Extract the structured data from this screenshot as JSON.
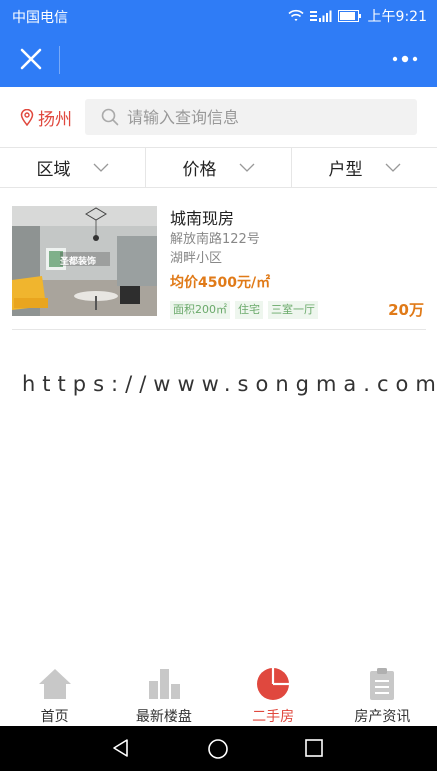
{
  "status_bar": {
    "carrier": "中国电信",
    "time": "上午9:21"
  },
  "nav": {
    "close_icon": "close-icon",
    "more_icon": "more-icon"
  },
  "search": {
    "city": "扬州",
    "placeholder": "请输入查询信息"
  },
  "filters": [
    {
      "label": "区域"
    },
    {
      "label": "价格"
    },
    {
      "label": "户型"
    }
  ],
  "listings": [
    {
      "title": "城南现房",
      "address": "解放南路122号",
      "community": "湖畔小区",
      "unit_price": "均价4500元/㎡",
      "tags": [
        "面积200㎡",
        "住宅",
        "三室一厅"
      ],
      "total_price": "20万",
      "image_logo_text": "圣都装饰"
    }
  ],
  "watermark": "https://www.songma.com",
  "tabbar": [
    {
      "label": "首页",
      "icon": "home-icon",
      "active": false
    },
    {
      "label": "最新楼盘",
      "icon": "buildings-icon",
      "active": false
    },
    {
      "label": "二手房",
      "icon": "pie-icon",
      "active": true
    },
    {
      "label": "房产资讯",
      "icon": "clipboard-icon",
      "active": false
    }
  ],
  "colors": {
    "primary": "#2f7cf6",
    "accent_red": "#e0483e",
    "price_orange": "#e07a18",
    "tag_green": "#6aa96a"
  }
}
